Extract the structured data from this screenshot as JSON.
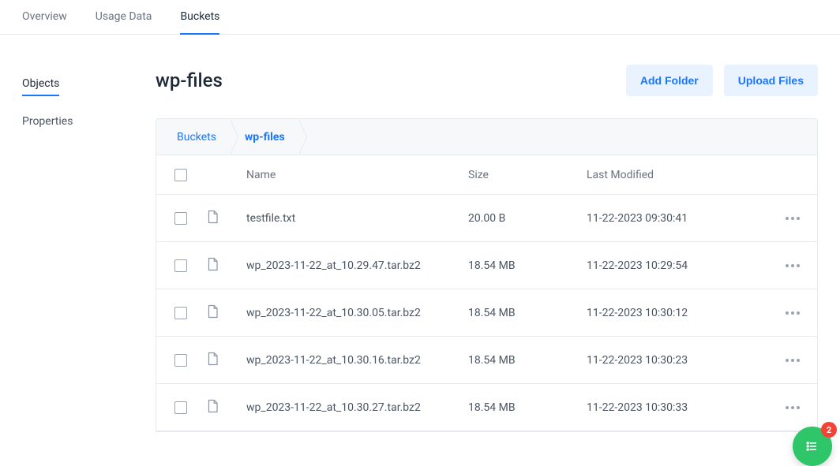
{
  "topTabs": [
    {
      "label": "Overview",
      "active": false
    },
    {
      "label": "Usage Data",
      "active": false
    },
    {
      "label": "Buckets",
      "active": true
    }
  ],
  "sideItems": [
    {
      "label": "Objects",
      "active": true
    },
    {
      "label": "Properties",
      "active": false
    }
  ],
  "header": {
    "title": "wp-files",
    "addFolder": "Add Folder",
    "uploadFiles": "Upload Files"
  },
  "breadcrumb": [
    {
      "label": "Buckets",
      "current": false
    },
    {
      "label": "wp-files",
      "current": true
    }
  ],
  "columns": {
    "name": "Name",
    "size": "Size",
    "lastModified": "Last Modified"
  },
  "rows": [
    {
      "name": "testfile.txt",
      "size": "20.00 B",
      "modified": "11-22-2023 09:30:41"
    },
    {
      "name": "wp_2023-11-22_at_10.29.47.tar.bz2",
      "size": "18.54 MB",
      "modified": "11-22-2023 10:29:54"
    },
    {
      "name": "wp_2023-11-22_at_10.30.05.tar.bz2",
      "size": "18.54 MB",
      "modified": "11-22-2023 10:30:12"
    },
    {
      "name": "wp_2023-11-22_at_10.30.16.tar.bz2",
      "size": "18.54 MB",
      "modified": "11-22-2023 10:30:23"
    },
    {
      "name": "wp_2023-11-22_at_10.30.27.tar.bz2",
      "size": "18.54 MB",
      "modified": "11-22-2023 10:30:33"
    }
  ],
  "fabBadge": "2"
}
